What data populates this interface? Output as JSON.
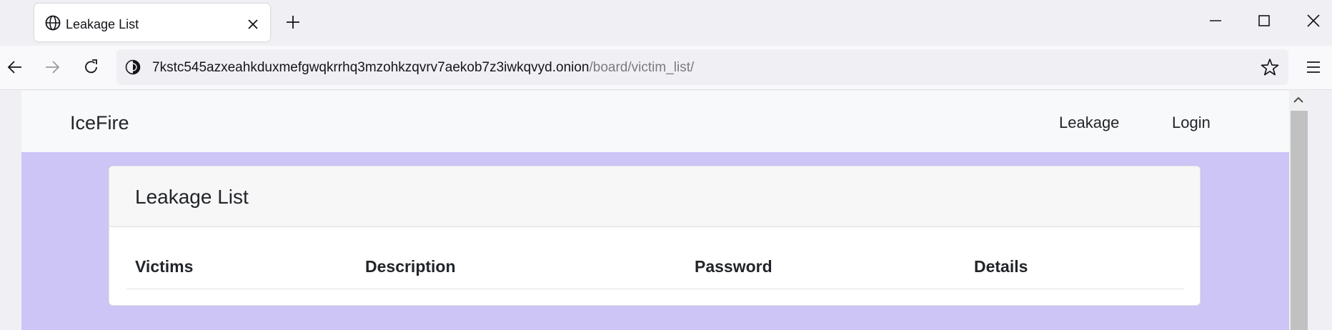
{
  "browser": {
    "tab": {
      "title": "Leakage List",
      "icon": "globe-icon"
    },
    "address": {
      "host": "7kstc545azxeahkduxmefgwqkrrhq3mzohkzqvrv7aekob7z3iwkqvyd.onion",
      "path": "/board/victim_list/"
    }
  },
  "site": {
    "brand": "IceFire",
    "nav": [
      {
        "label": "Leakage"
      },
      {
        "label": "Login"
      }
    ],
    "background_color": "#ccc5f5"
  },
  "card": {
    "title": "Leakage List",
    "columns": [
      "Victims",
      "Description",
      "Password",
      "Details"
    ]
  }
}
